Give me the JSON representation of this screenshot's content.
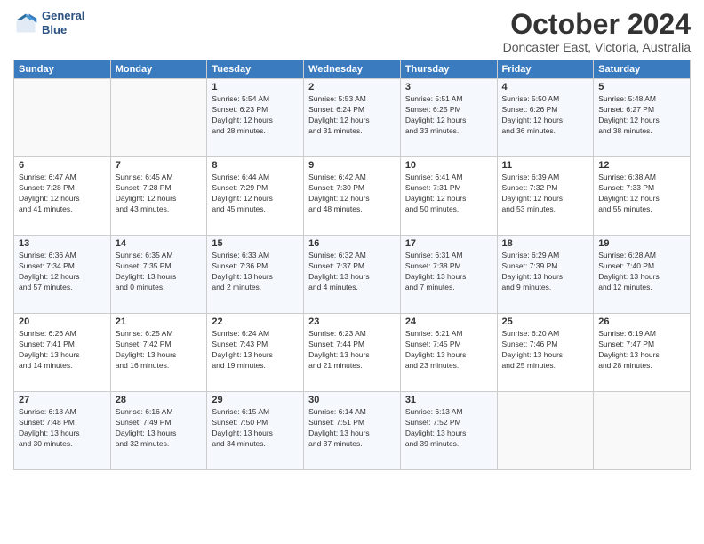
{
  "logo": {
    "line1": "General",
    "line2": "Blue"
  },
  "header": {
    "month": "October 2024",
    "location": "Doncaster East, Victoria, Australia"
  },
  "days_of_week": [
    "Sunday",
    "Monday",
    "Tuesday",
    "Wednesday",
    "Thursday",
    "Friday",
    "Saturday"
  ],
  "weeks": [
    [
      {
        "day": "",
        "info": ""
      },
      {
        "day": "",
        "info": ""
      },
      {
        "day": "1",
        "info": "Sunrise: 5:54 AM\nSunset: 6:23 PM\nDaylight: 12 hours\nand 28 minutes."
      },
      {
        "day": "2",
        "info": "Sunrise: 5:53 AM\nSunset: 6:24 PM\nDaylight: 12 hours\nand 31 minutes."
      },
      {
        "day": "3",
        "info": "Sunrise: 5:51 AM\nSunset: 6:25 PM\nDaylight: 12 hours\nand 33 minutes."
      },
      {
        "day": "4",
        "info": "Sunrise: 5:50 AM\nSunset: 6:26 PM\nDaylight: 12 hours\nand 36 minutes."
      },
      {
        "day": "5",
        "info": "Sunrise: 5:48 AM\nSunset: 6:27 PM\nDaylight: 12 hours\nand 38 minutes."
      }
    ],
    [
      {
        "day": "6",
        "info": "Sunrise: 6:47 AM\nSunset: 7:28 PM\nDaylight: 12 hours\nand 41 minutes."
      },
      {
        "day": "7",
        "info": "Sunrise: 6:45 AM\nSunset: 7:28 PM\nDaylight: 12 hours\nand 43 minutes."
      },
      {
        "day": "8",
        "info": "Sunrise: 6:44 AM\nSunset: 7:29 PM\nDaylight: 12 hours\nand 45 minutes."
      },
      {
        "day": "9",
        "info": "Sunrise: 6:42 AM\nSunset: 7:30 PM\nDaylight: 12 hours\nand 48 minutes."
      },
      {
        "day": "10",
        "info": "Sunrise: 6:41 AM\nSunset: 7:31 PM\nDaylight: 12 hours\nand 50 minutes."
      },
      {
        "day": "11",
        "info": "Sunrise: 6:39 AM\nSunset: 7:32 PM\nDaylight: 12 hours\nand 53 minutes."
      },
      {
        "day": "12",
        "info": "Sunrise: 6:38 AM\nSunset: 7:33 PM\nDaylight: 12 hours\nand 55 minutes."
      }
    ],
    [
      {
        "day": "13",
        "info": "Sunrise: 6:36 AM\nSunset: 7:34 PM\nDaylight: 12 hours\nand 57 minutes."
      },
      {
        "day": "14",
        "info": "Sunrise: 6:35 AM\nSunset: 7:35 PM\nDaylight: 13 hours\nand 0 minutes."
      },
      {
        "day": "15",
        "info": "Sunrise: 6:33 AM\nSunset: 7:36 PM\nDaylight: 13 hours\nand 2 minutes."
      },
      {
        "day": "16",
        "info": "Sunrise: 6:32 AM\nSunset: 7:37 PM\nDaylight: 13 hours\nand 4 minutes."
      },
      {
        "day": "17",
        "info": "Sunrise: 6:31 AM\nSunset: 7:38 PM\nDaylight: 13 hours\nand 7 minutes."
      },
      {
        "day": "18",
        "info": "Sunrise: 6:29 AM\nSunset: 7:39 PM\nDaylight: 13 hours\nand 9 minutes."
      },
      {
        "day": "19",
        "info": "Sunrise: 6:28 AM\nSunset: 7:40 PM\nDaylight: 13 hours\nand 12 minutes."
      }
    ],
    [
      {
        "day": "20",
        "info": "Sunrise: 6:26 AM\nSunset: 7:41 PM\nDaylight: 13 hours\nand 14 minutes."
      },
      {
        "day": "21",
        "info": "Sunrise: 6:25 AM\nSunset: 7:42 PM\nDaylight: 13 hours\nand 16 minutes."
      },
      {
        "day": "22",
        "info": "Sunrise: 6:24 AM\nSunset: 7:43 PM\nDaylight: 13 hours\nand 19 minutes."
      },
      {
        "day": "23",
        "info": "Sunrise: 6:23 AM\nSunset: 7:44 PM\nDaylight: 13 hours\nand 21 minutes."
      },
      {
        "day": "24",
        "info": "Sunrise: 6:21 AM\nSunset: 7:45 PM\nDaylight: 13 hours\nand 23 minutes."
      },
      {
        "day": "25",
        "info": "Sunrise: 6:20 AM\nSunset: 7:46 PM\nDaylight: 13 hours\nand 25 minutes."
      },
      {
        "day": "26",
        "info": "Sunrise: 6:19 AM\nSunset: 7:47 PM\nDaylight: 13 hours\nand 28 minutes."
      }
    ],
    [
      {
        "day": "27",
        "info": "Sunrise: 6:18 AM\nSunset: 7:48 PM\nDaylight: 13 hours\nand 30 minutes."
      },
      {
        "day": "28",
        "info": "Sunrise: 6:16 AM\nSunset: 7:49 PM\nDaylight: 13 hours\nand 32 minutes."
      },
      {
        "day": "29",
        "info": "Sunrise: 6:15 AM\nSunset: 7:50 PM\nDaylight: 13 hours\nand 34 minutes."
      },
      {
        "day": "30",
        "info": "Sunrise: 6:14 AM\nSunset: 7:51 PM\nDaylight: 13 hours\nand 37 minutes."
      },
      {
        "day": "31",
        "info": "Sunrise: 6:13 AM\nSunset: 7:52 PM\nDaylight: 13 hours\nand 39 minutes."
      },
      {
        "day": "",
        "info": ""
      },
      {
        "day": "",
        "info": ""
      }
    ]
  ]
}
